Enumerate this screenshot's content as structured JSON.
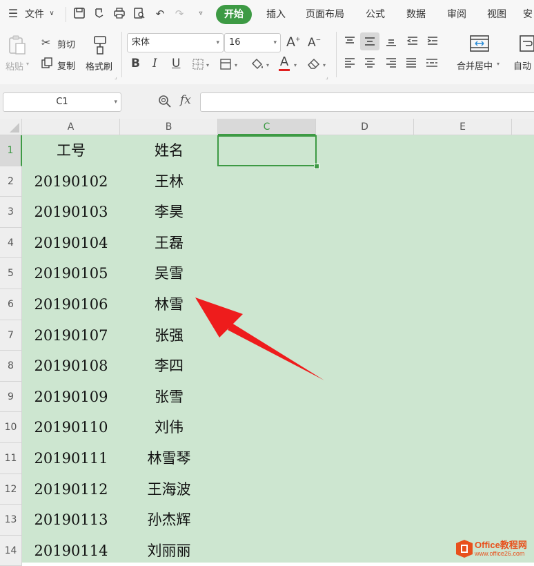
{
  "menu": {
    "file_label": "文件",
    "tabs": [
      "开始",
      "插入",
      "页面布局",
      "公式",
      "数据",
      "审阅",
      "视图",
      "安"
    ],
    "active_tab": "开始"
  },
  "ribbon": {
    "paste_label": "粘贴",
    "cut_label": "剪切",
    "copy_label": "复制",
    "format_painter_label": "格式刷",
    "font_name": "宋体",
    "font_size": "16",
    "merge_center_label": "合并居中",
    "auto_wrap_label": "自动",
    "increase_font_glyph": "A",
    "decrease_font_glyph": "A",
    "bold_glyph": "B",
    "italic_glyph": "I",
    "underline_glyph": "U",
    "font_color_glyph": "A",
    "font_color": "#e02020"
  },
  "formula_bar": {
    "name_box": "C1",
    "fx_label": "fx",
    "value": ""
  },
  "sheet": {
    "columns": [
      "A",
      "B",
      "C",
      "D",
      "E"
    ],
    "selected_column": "C",
    "selected_cell": "C1",
    "row_numbers": [
      "1",
      "2",
      "3",
      "4",
      "5",
      "6",
      "7",
      "8",
      "9",
      "10",
      "11",
      "12",
      "13",
      "14"
    ],
    "rows": [
      [
        "工号",
        "姓名"
      ],
      [
        "20190102",
        "王林"
      ],
      [
        "20190103",
        "李昊"
      ],
      [
        "20190104",
        "王磊"
      ],
      [
        "20190105",
        "吴雪"
      ],
      [
        "20190106",
        "林雪"
      ],
      [
        "20190107",
        "张强"
      ],
      [
        "20190108",
        "李四"
      ],
      [
        "20190109",
        "张雪"
      ],
      [
        "20190110",
        "刘伟"
      ],
      [
        "20190111",
        "林雪琴"
      ],
      [
        "20190112",
        "王海波"
      ],
      [
        "20190113",
        "孙杰辉"
      ],
      [
        "20190114",
        "刘丽丽"
      ]
    ],
    "cell_background": "#cde6d0",
    "selection_color": "#3d9a44"
  },
  "annotation": {
    "arrow_color": "#ee1c1c"
  },
  "watermark": {
    "brand": "Office教程网",
    "url": "www.office26.com"
  }
}
